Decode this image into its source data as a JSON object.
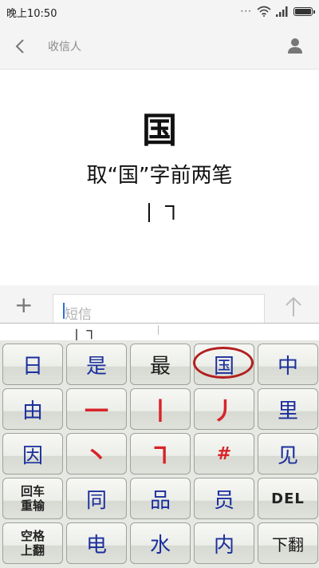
{
  "status": {
    "time": "晚上10:50",
    "dots": "···"
  },
  "header": {
    "title": "收信人"
  },
  "content": {
    "big_char": "国",
    "line2": "取“国”字前两笔",
    "line3": "丨㇕"
  },
  "input": {
    "plus": "+",
    "placeholder": "短信"
  },
  "candidate": {
    "text": "丨㇕"
  },
  "keyboard": {
    "row1": [
      "日",
      "是",
      "最",
      "国",
      "中"
    ],
    "row2": [
      "由",
      "一",
      "丨",
      "丿",
      "里"
    ],
    "row3": [
      "因",
      "丶",
      "㇕",
      "#",
      "见"
    ],
    "row4": [
      "回车\n重输",
      "同",
      "品",
      "员",
      "DEL"
    ],
    "row5": [
      "空格\n上翻",
      "电",
      "水",
      "内",
      "下翻"
    ]
  },
  "colors": {
    "blue_key": "#1b2f9c",
    "red_key": "#d8232a",
    "circle": "#b21f1f",
    "cursor": "#2a6fd6"
  },
  "icons": [
    "back-arrow-icon",
    "person-icon",
    "wifi-icon",
    "signal-icon",
    "battery-icon",
    "plus-icon",
    "send-arrow-icon"
  ]
}
